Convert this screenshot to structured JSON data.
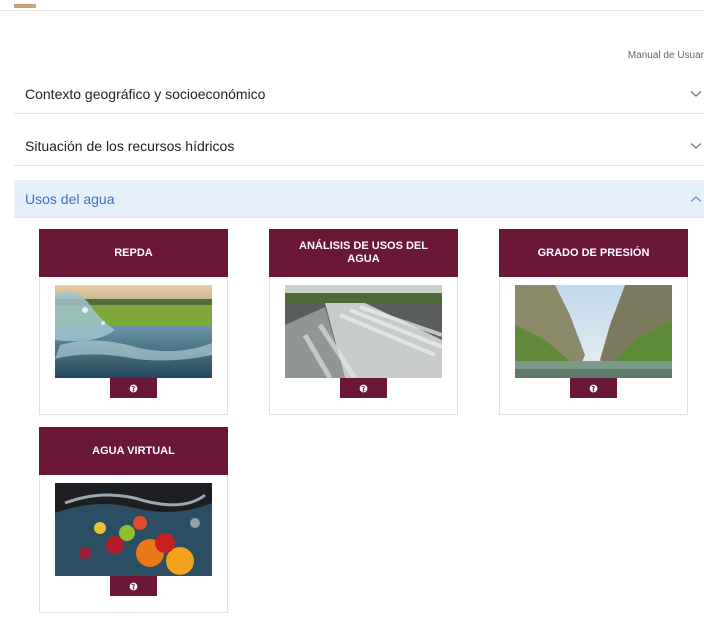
{
  "header": {
    "manual_link": "Manual de Usuar"
  },
  "accordion": [
    {
      "label": "Contexto geográfico y socioeconómico",
      "expanded": false
    },
    {
      "label": "Situación de los recursos hídricos",
      "expanded": false
    },
    {
      "label": "Usos del agua",
      "expanded": true
    }
  ],
  "cards": [
    {
      "title": "REPDA",
      "image": "water-splash-field-image",
      "button_icon": "globe-icon"
    },
    {
      "title": "ANÁLISIS DE USOS DEL AGUA",
      "image": "irrigation-channel-image",
      "button_icon": "globe-icon"
    },
    {
      "title": "GRADO DE PRESIÓN",
      "image": "canyon-river-image",
      "button_icon": "globe-icon"
    },
    {
      "title": "AGUA VIRTUAL",
      "image": "fruits-in-water-image",
      "button_icon": "globe-icon"
    }
  ],
  "colors": {
    "card_header": "#6b1737",
    "active_row_bg": "#e6f0fb",
    "active_row_text": "#3b73c8"
  }
}
